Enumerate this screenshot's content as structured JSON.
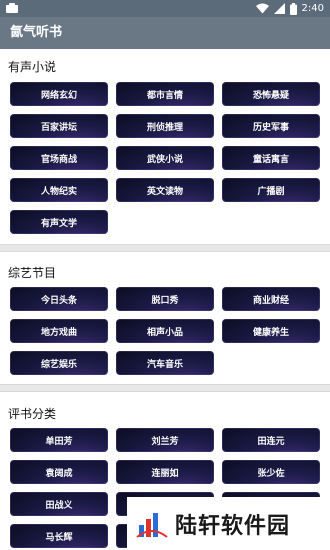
{
  "status_bar": {
    "time": "2:40"
  },
  "app_bar": {
    "title": "氤气听书"
  },
  "sections": [
    {
      "title": "有声小说",
      "items": [
        "网络玄幻",
        "都市言情",
        "恐怖悬疑",
        "百家讲坛",
        "刑侦推理",
        "历史军事",
        "官场商战",
        "武侠小说",
        "童话寓言",
        "人物纪实",
        "英文读物",
        "广播剧",
        "有声文学"
      ]
    },
    {
      "title": "综艺节目",
      "items": [
        "今日头条",
        "脱口秀",
        "商业财经",
        "地方戏曲",
        "相声小品",
        "健康养生",
        "综艺娱乐",
        "汽车音乐"
      ]
    },
    {
      "title": "评书分类",
      "items": [
        "单田芳",
        "刘兰芳",
        "田连元",
        "袁阔成",
        "连丽如",
        "张少佐",
        "田战义",
        "",
        "",
        "马长辉",
        "",
        ""
      ]
    }
  ],
  "watermark": {
    "text": "陆轩软件园"
  },
  "colors": {
    "status_bar": "#5b6b7a",
    "app_bar": "#6a7886",
    "button_bg": "#15153a",
    "separator": "#e8e8e8"
  }
}
